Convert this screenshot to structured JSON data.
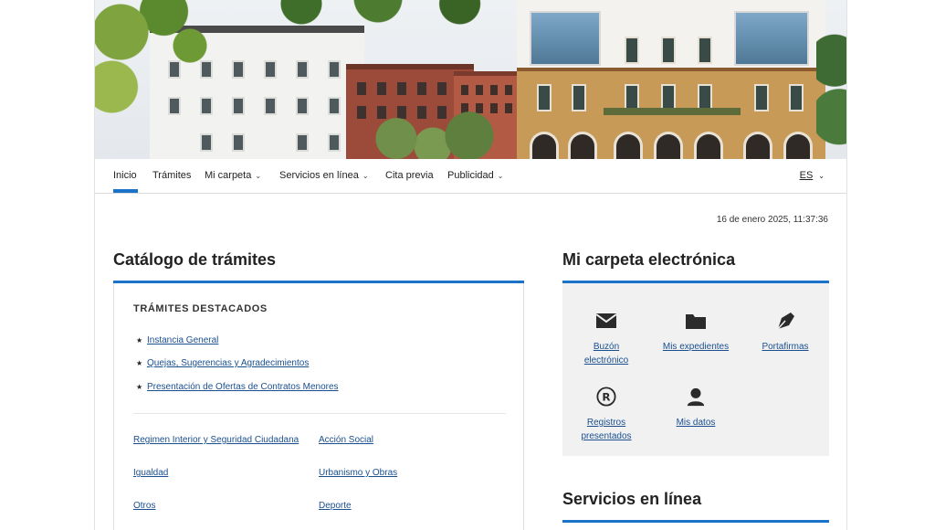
{
  "nav": {
    "items": [
      {
        "label": "Inicio",
        "dropdown": false
      },
      {
        "label": "Trámites",
        "dropdown": false
      },
      {
        "label": "Mi carpeta",
        "dropdown": true
      },
      {
        "label": "Servicios en línea",
        "dropdown": true
      },
      {
        "label": "Cita previa",
        "dropdown": false
      },
      {
        "label": "Publicidad",
        "dropdown": true
      }
    ],
    "active": "Inicio",
    "lang": "ES"
  },
  "datetime": "16 de enero 2025, 11:37:36",
  "catalog": {
    "heading": "Catálogo de trámites",
    "featured_title": "TRÁMITES DESTACADOS",
    "featured": [
      "Instancia General",
      "Quejas, Sugerencias y Agradecimientos",
      "Presentación de Ofertas de Contratos Menores"
    ],
    "categories": [
      "Regimen Interior y Seguridad Ciudadana",
      "Acción Social",
      "Igualdad",
      "Urbanismo y Obras",
      "Otros",
      "Deporte"
    ]
  },
  "carpeta": {
    "heading": "Mi carpeta electrónica",
    "tiles": [
      {
        "line1": "Buzón",
        "line2": "electrónico",
        "icon": "envelope-icon"
      },
      {
        "line1": "Mis expedientes",
        "line2": "",
        "icon": "folder-icon"
      },
      {
        "line1": "Portafirmas",
        "line2": "",
        "icon": "pen-nib-icon"
      },
      {
        "line1": "Registros",
        "line2": "presentados",
        "icon": "registered-icon"
      },
      {
        "line1": "Mis datos",
        "line2": "",
        "icon": "user-icon"
      }
    ]
  },
  "servicios": {
    "heading": "Servicios en línea"
  },
  "colors": {
    "accent": "#1a73c9",
    "link": "#1a4f8f",
    "panel": "#f1f1f1"
  }
}
